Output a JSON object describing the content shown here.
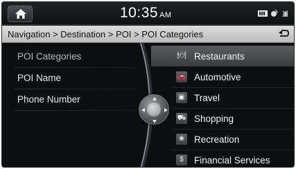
{
  "topbar": {
    "time": "10:35",
    "ampm": "AM",
    "home_icon": "home-icon",
    "status_icons": [
      "card-icon",
      "bluetooth-icon",
      "signal-icon"
    ]
  },
  "breadcrumb": {
    "text": "Navigation > Destination > POI > POI Categories",
    "back_icon": "back-arrow-icon"
  },
  "left_menu": {
    "items": [
      {
        "label": "POI Categories"
      },
      {
        "label": "POI Name"
      },
      {
        "label": "Phone Number"
      }
    ]
  },
  "categories": {
    "items": [
      {
        "label": "Restaurants",
        "icon": "restaurant-icon",
        "glyph": "🍽"
      },
      {
        "label": "Automotive",
        "icon": "car-icon",
        "glyph": "🚗"
      },
      {
        "label": "Travel",
        "icon": "suitcase-icon",
        "glyph": "▣"
      },
      {
        "label": "Shopping",
        "icon": "shopping-bag-icon",
        "glyph": "⛟"
      },
      {
        "label": "Recreation",
        "icon": "recreation-icon",
        "glyph": "❀"
      },
      {
        "label": "Financial Services",
        "icon": "dollar-icon",
        "glyph": "$"
      }
    ],
    "selected_index": 0
  },
  "colors": {
    "background": "#0d0e10",
    "breadcrumb_bar": "#c8c8c8",
    "selected_row": "#4a4c50"
  }
}
